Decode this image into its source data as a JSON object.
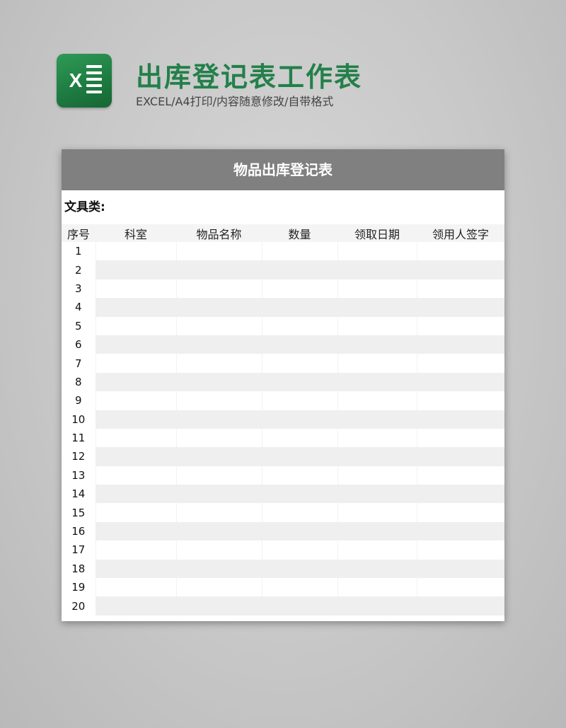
{
  "header": {
    "title": "出库登记表工作表",
    "subtitle": "EXCEL/A4打印/内容随意修改/自带格式",
    "logo_icon": "excel-icon",
    "logo_letter": "X",
    "brand_color": "#23804a"
  },
  "sheet": {
    "title": "物品出库登记表",
    "category_label": "文具类:",
    "columns": [
      "序号",
      "科室",
      "物品名称",
      "数量",
      "领取日期",
      "领用人签字"
    ],
    "rows": [
      [
        "1",
        "",
        "",
        "",
        "",
        ""
      ],
      [
        "2",
        "",
        "",
        "",
        "",
        ""
      ],
      [
        "3",
        "",
        "",
        "",
        "",
        ""
      ],
      [
        "4",
        "",
        "",
        "",
        "",
        ""
      ],
      [
        "5",
        "",
        "",
        "",
        "",
        ""
      ],
      [
        "6",
        "",
        "",
        "",
        "",
        ""
      ],
      [
        "7",
        "",
        "",
        "",
        "",
        ""
      ],
      [
        "8",
        "",
        "",
        "",
        "",
        ""
      ],
      [
        "9",
        "",
        "",
        "",
        "",
        ""
      ],
      [
        "10",
        "",
        "",
        "",
        "",
        ""
      ],
      [
        "11",
        "",
        "",
        "",
        "",
        ""
      ],
      [
        "12",
        "",
        "",
        "",
        "",
        ""
      ],
      [
        "13",
        "",
        "",
        "",
        "",
        ""
      ],
      [
        "14",
        "",
        "",
        "",
        "",
        ""
      ],
      [
        "15",
        "",
        "",
        "",
        "",
        ""
      ],
      [
        "16",
        "",
        "",
        "",
        "",
        ""
      ],
      [
        "17",
        "",
        "",
        "",
        "",
        ""
      ],
      [
        "18",
        "",
        "",
        "",
        "",
        ""
      ],
      [
        "19",
        "",
        "",
        "",
        "",
        ""
      ],
      [
        "20",
        "",
        "",
        "",
        "",
        ""
      ]
    ],
    "band_color": "#808080"
  }
}
